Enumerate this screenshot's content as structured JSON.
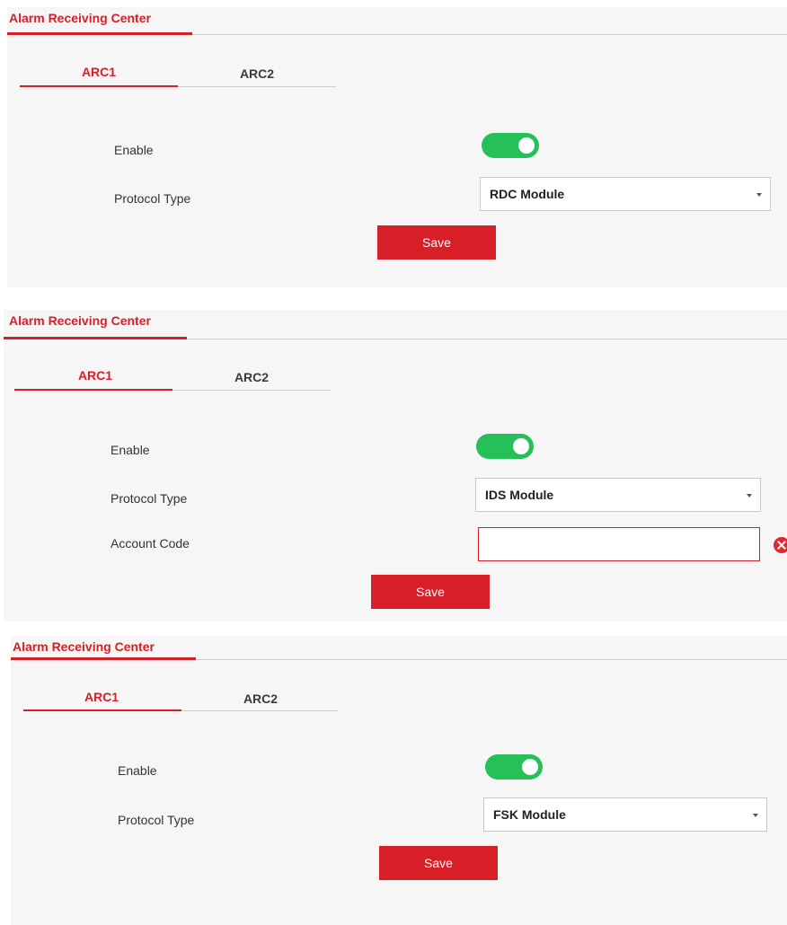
{
  "panels": [
    {
      "header_title": "Alarm Receiving Center",
      "tabs": [
        "ARC1",
        "ARC2"
      ],
      "enable_label": "Enable",
      "enable_on": true,
      "protocol_label": "Protocol Type",
      "protocol_value": "RDC Module",
      "save_label": "Save"
    },
    {
      "header_title": "Alarm Receiving Center",
      "tabs": [
        "ARC1",
        "ARC2"
      ],
      "enable_label": "Enable",
      "enable_on": true,
      "protocol_label": "Protocol Type",
      "protocol_value": "IDS Module",
      "account_label": "Account Code",
      "account_value": "",
      "save_label": "Save"
    },
    {
      "header_title": "Alarm Receiving Center",
      "tabs": [
        "ARC1",
        "ARC2"
      ],
      "enable_label": "Enable",
      "enable_on": true,
      "protocol_label": "Protocol Type",
      "protocol_value": "FSK Module",
      "save_label": "Save"
    }
  ],
  "colors": {
    "accent": "#d81e27",
    "toggle_on": "#25c057",
    "panel_bg": "#f6f6f6"
  }
}
